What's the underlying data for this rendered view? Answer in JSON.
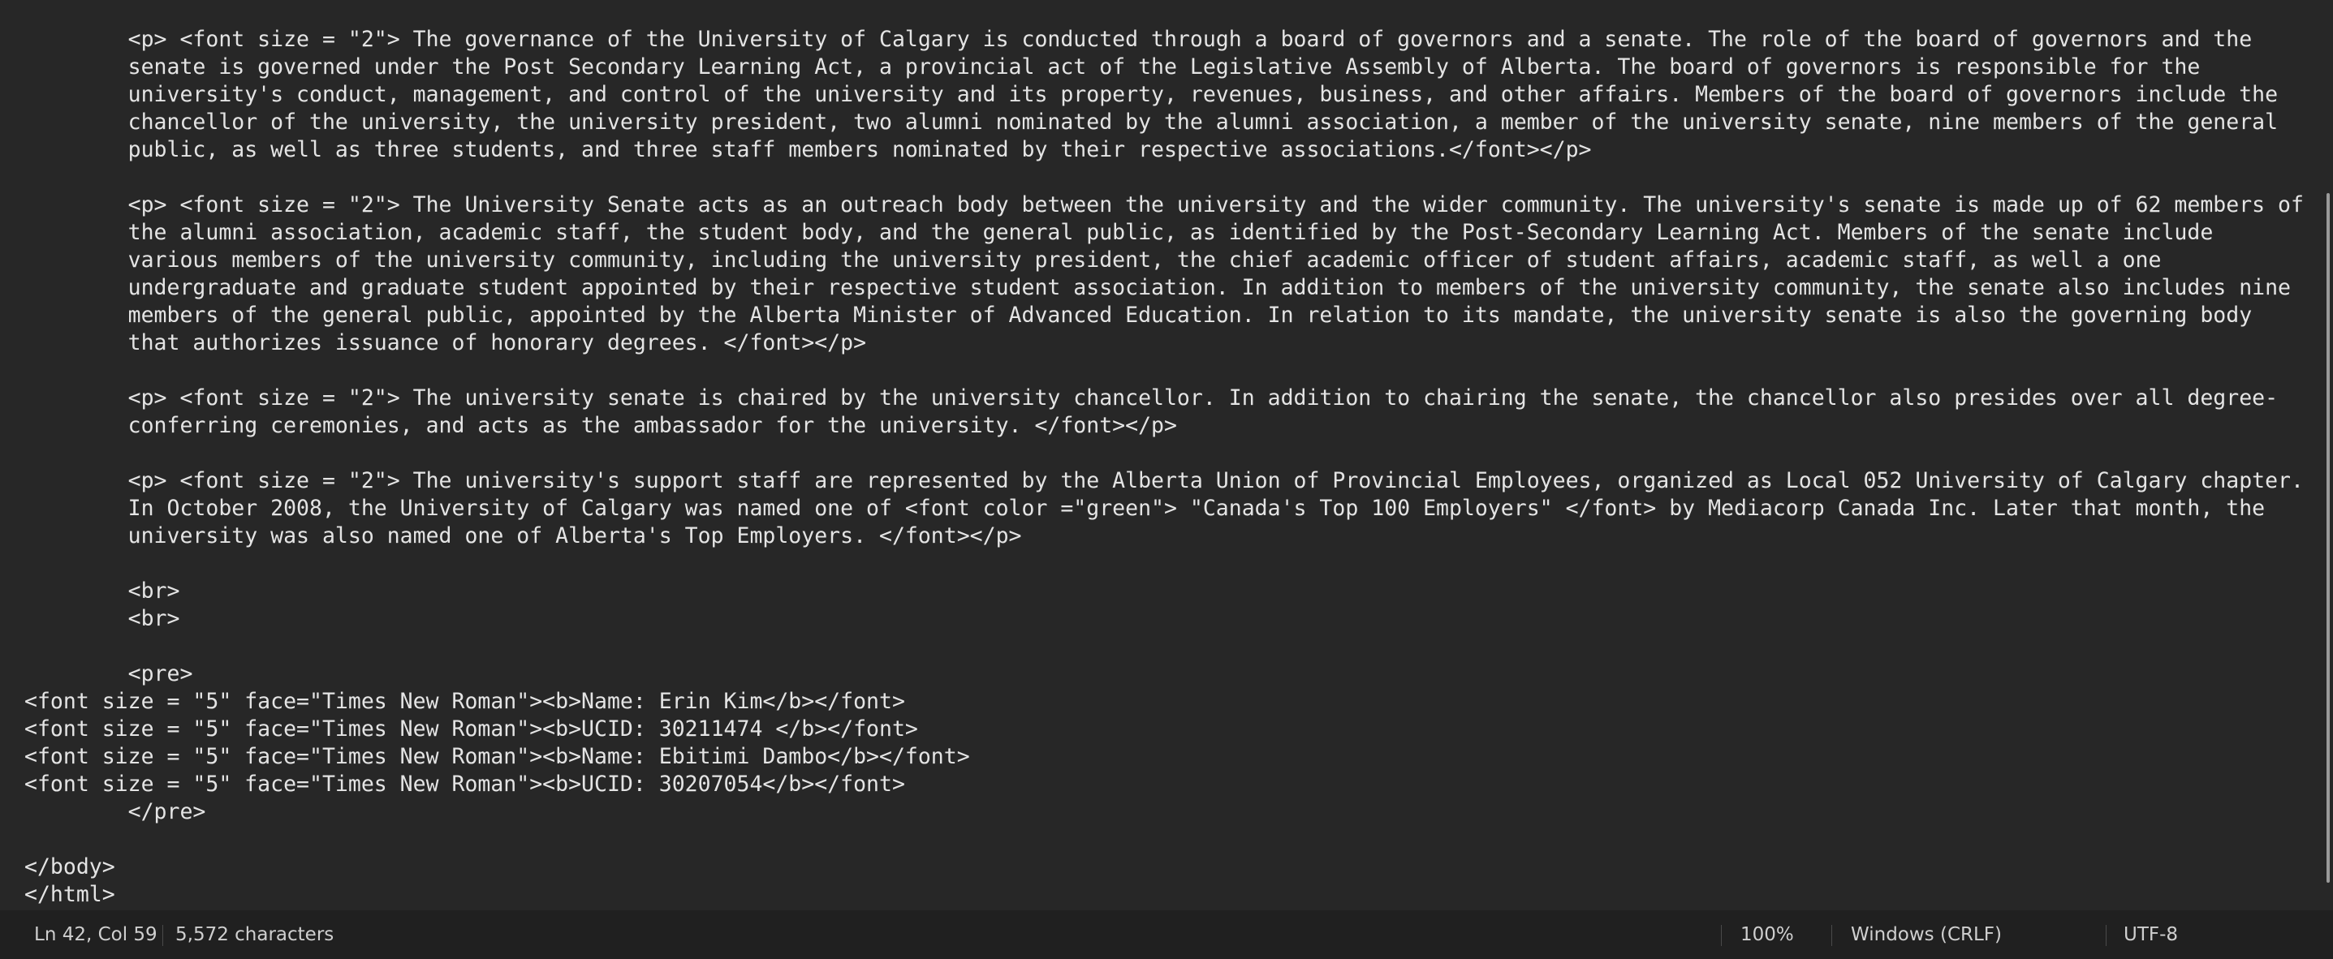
{
  "editor": {
    "lines": [
      "        <p> <font size = \"2\"> The governance of the University of Calgary is conducted through a board of governors and a senate. The role of the board of governors and the",
      "        senate is governed under the Post Secondary Learning Act, a provincial act of the Legislative Assembly of Alberta. The board of governors is responsible for the",
      "        university's conduct, management, and control of the university and its property, revenues, business, and other affairs. Members of the board of governors include the",
      "        chancellor of the university, the university president, two alumni nominated by the alumni association, a member of the university senate, nine members of the general",
      "        public, as well as three students, and three staff members nominated by their respective associations.</font></p>",
      "",
      "        <p> <font size = \"2\"> The University Senate acts as an outreach body between the university and the wider community. The university's senate is made up of 62 members of",
      "        the alumni association, academic staff, the student body, and the general public, as identified by the Post-Secondary Learning Act. Members of the senate include",
      "        various members of the university community, including the university president, the chief academic officer of student affairs, academic staff, as well a one",
      "        undergraduate and graduate student appointed by their respective student association. In addition to members of the university community, the senate also includes nine",
      "        members of the general public, appointed by the Alberta Minister of Advanced Education. In relation to its mandate, the university senate is also the governing body",
      "        that authorizes issuance of honorary degrees. </font></p>",
      "",
      "        <p> <font size = \"2\"> The university senate is chaired by the university chancellor. In addition to chairing the senate, the chancellor also presides over all degree-",
      "        conferring ceremonies, and acts as the ambassador for the university. </font></p>",
      "",
      "        <p> <font size = \"2\"> The university's support staff are represented by the Alberta Union of Provincial Employees, organized as Local 052 University of Calgary chapter.",
      "        In October 2008, the University of Calgary was named one of <font color =\"green\"> \"Canada's Top 100 Employers\" </font> by Mediacorp Canada Inc. Later that month, the",
      "        university was also named one of Alberta's Top Employers. </font></p>",
      "",
      "        <br>",
      "        <br>",
      "",
      "        <pre>",
      "<font size = \"5\" face=\"Times New Roman\"><b>Name: Erin Kim</b></font>",
      "<font size = \"5\" face=\"Times New Roman\"><b>UCID: 30211474 </b></font>",
      "<font size = \"5\" face=\"Times New Roman\"><b>Name: Ebitimi Dambo</b></font>",
      "<font size = \"5\" face=\"Times New Roman\"><b>UCID: 30207054</b></font>",
      "        </pre>",
      "",
      "</body>",
      "</html>"
    ]
  },
  "statusbar": {
    "position": "Ln 42, Col 59",
    "characters": "5,572 characters",
    "zoom": "100%",
    "line_ending": "Windows (CRLF)",
    "encoding": "UTF-8"
  }
}
